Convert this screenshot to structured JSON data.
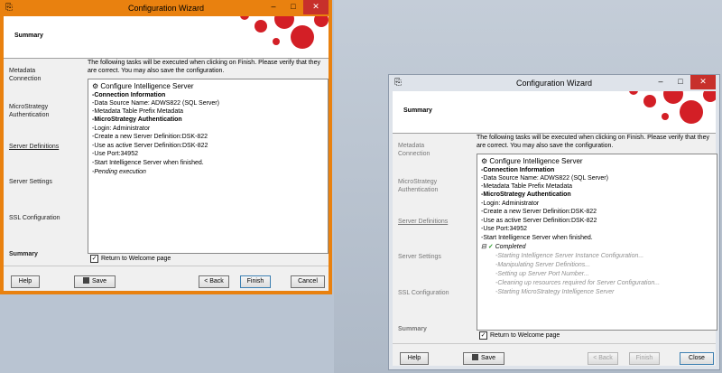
{
  "window_title": "Configuration Wizard",
  "header_title": "Summary",
  "intro_text": "The following tasks will be executed when clicking on Finish. Please verify that they are correct. You may also save the configuration.",
  "nav": {
    "metadata_1": "Metadata",
    "metadata_2": "Connection",
    "microstrategy_1": "MicroStrategy",
    "microstrategy_2": "Authentication",
    "server_definitions": "Server Definitions",
    "server_settings": "Server Settings",
    "ssl_configuration": "SSL Configuration",
    "summary": "Summary"
  },
  "tree": {
    "root": "Configure Intelligence Server",
    "items": [
      "Connection Information",
      "Data Source Name: ADWS822 (SQL Server)",
      "Metadata Table Prefix Metadata",
      "MicroStrategy Authentication",
      "Login: Administrator",
      "Create a new Server Definition:DSK-822",
      "Use as active Server Definition:DSK-822",
      "Use Port:34952",
      "Start Intelligence Server when finished."
    ],
    "pending": "Pending execution",
    "completed": "Completed",
    "progress": [
      "Starting Intelligence Server Instance Configuration...",
      "Manipulating Server Definitions...",
      "Setting up Server Port Number...",
      "Cleaning up resources required for Server Configuration...",
      "Starting MicroStrategy Intelligence Server"
    ]
  },
  "return_to_welcome": "Return to Welcome page",
  "buttons": {
    "help": "Help",
    "save": "Save",
    "back": "< Back",
    "finish": "Finish",
    "cancel": "Cancel",
    "close": "Close"
  },
  "window_controls": {
    "minimize": "–",
    "maximize": "□",
    "close": "✕"
  },
  "colors": {
    "active_frame": "#e9810f",
    "inactive_frame": "#dee3ea",
    "brand_red": "#d31f26"
  }
}
